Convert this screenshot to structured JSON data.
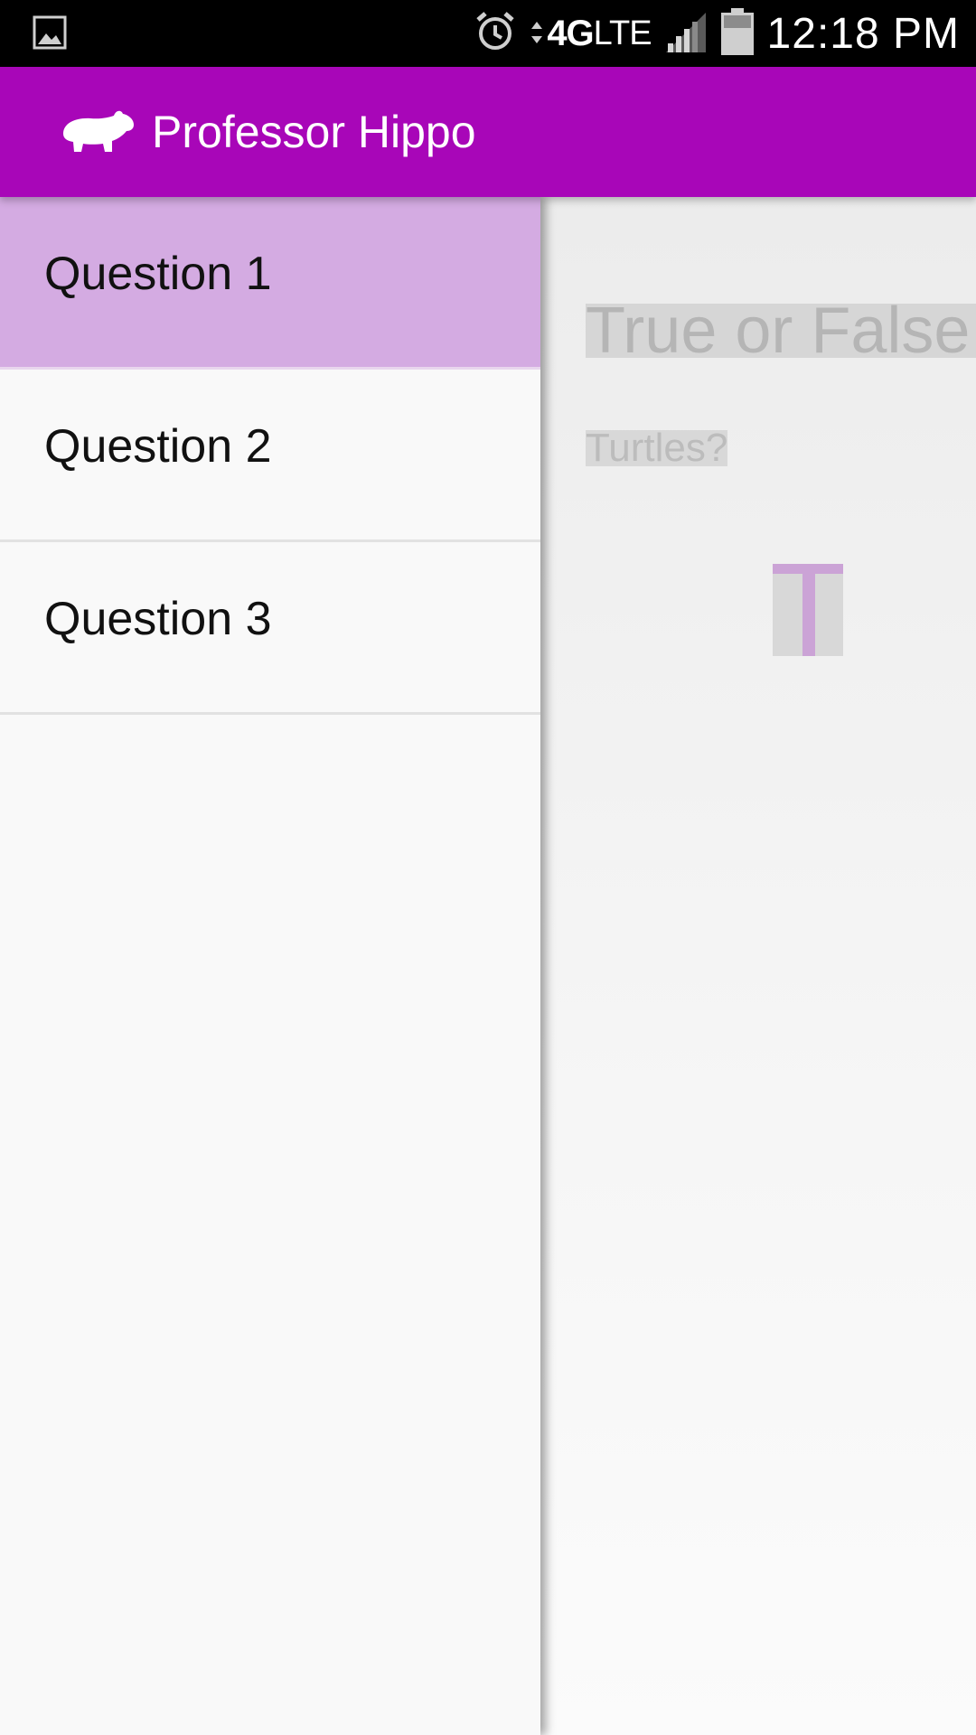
{
  "status_bar": {
    "time": "12:18 PM",
    "network": "4G",
    "network_suffix": "LTE",
    "icons": [
      "gallery-icon",
      "alarm-icon",
      "data-arrows-icon",
      "signal-icon",
      "battery-icon"
    ]
  },
  "app_bar": {
    "title": "Professor Hippo",
    "logo_icon": "hippo-icon",
    "color": "#a806b8"
  },
  "drawer": {
    "items": [
      {
        "label": "Question 1",
        "selected": true
      },
      {
        "label": "Question 2",
        "selected": false
      },
      {
        "label": "Question 3",
        "selected": false
      }
    ],
    "selected_color": "#d4abe2"
  },
  "content": {
    "question_type": "True or False",
    "question_text": "Turtles?",
    "answer_button": "T"
  }
}
